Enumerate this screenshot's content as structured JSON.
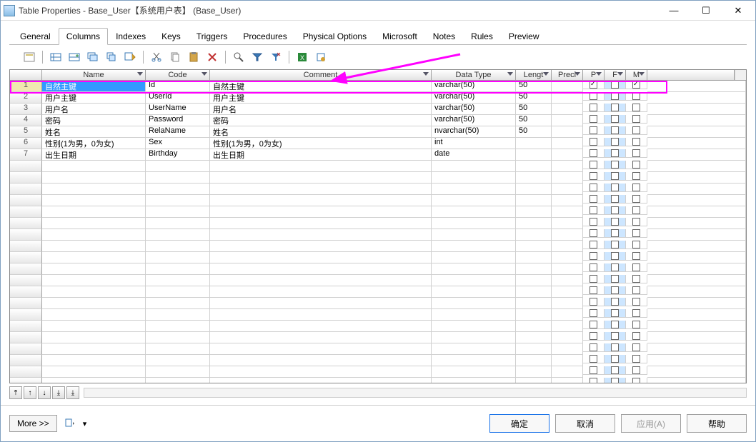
{
  "window": {
    "title": "Table Properties - Base_User【系统用户表】 (Base_User)"
  },
  "tabs": [
    "General",
    "Columns",
    "Indexes",
    "Keys",
    "Triggers",
    "Procedures",
    "Physical Options",
    "Microsoft",
    "Notes",
    "Rules",
    "Preview"
  ],
  "activeTab": 1,
  "headers": {
    "name": "Name",
    "code": "Code",
    "comment": "Comment",
    "dtype": "Data Type",
    "length": "Lengt",
    "precision": "Preci",
    "p": "P",
    "f": "F",
    "m": "M"
  },
  "rows": [
    {
      "n": 1,
      "name": "自然主键",
      "code": "Id",
      "comment": "自然主键",
      "dtype": "varchar(50)",
      "len": "50",
      "prec": "",
      "p": true,
      "f": false,
      "m": true,
      "sel": true
    },
    {
      "n": 2,
      "name": "用户主键",
      "code": "UserId",
      "comment": "用户主键",
      "dtype": "varchar(50)",
      "len": "50",
      "prec": "",
      "p": false,
      "f": false,
      "m": false
    },
    {
      "n": 3,
      "name": "用户名",
      "code": "UserName",
      "comment": "用户名",
      "dtype": "varchar(50)",
      "len": "50",
      "prec": "",
      "p": false,
      "f": false,
      "m": false
    },
    {
      "n": 4,
      "name": "密码",
      "code": "Password",
      "comment": "密码",
      "dtype": "varchar(50)",
      "len": "50",
      "prec": "",
      "p": false,
      "f": false,
      "m": false
    },
    {
      "n": 5,
      "name": "姓名",
      "code": "RelaName",
      "comment": "姓名",
      "dtype": "nvarchar(50)",
      "len": "50",
      "prec": "",
      "p": false,
      "f": false,
      "m": false
    },
    {
      "n": 6,
      "name": "性别(1为男，0为女)",
      "code": "Sex",
      "comment": "性别(1为男，0为女)",
      "dtype": "int",
      "len": "",
      "prec": "",
      "p": false,
      "f": false,
      "m": false
    },
    {
      "n": 7,
      "name": "出生日期",
      "code": "Birthday",
      "comment": "出生日期",
      "dtype": "date",
      "len": "",
      "prec": "",
      "p": false,
      "f": false,
      "m": false
    }
  ],
  "emptyRowCount": 24,
  "buttons": {
    "more": "More >>",
    "ok": "确定",
    "cancel": "取消",
    "apply": "应用(A)",
    "help": "帮助"
  }
}
